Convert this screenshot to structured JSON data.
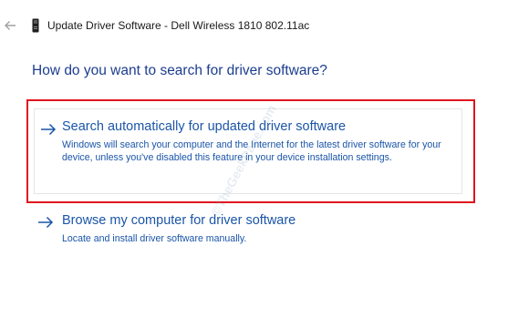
{
  "window": {
    "title": "Update Driver Software - Dell Wireless 1810 802.11ac",
    "back_icon": "back-arrow-icon",
    "device_icon": "device-icon"
  },
  "main": {
    "heading": "How do you want to search for driver software?",
    "options": [
      {
        "title": "Search automatically for updated driver software",
        "description": "Windows will search your computer and the Internet for the latest driver software for your device, unless you've disabled this feature in your device installation settings.",
        "icon": "right-arrow-icon",
        "highlighted": true
      },
      {
        "title": "Browse my computer for driver software",
        "description": "Locate and install driver software manually.",
        "icon": "right-arrow-icon",
        "highlighted": false
      }
    ]
  },
  "watermark": "©TheGeekPage.com",
  "colors": {
    "heading": "#1c3d8f",
    "link": "#1a55a8",
    "highlight_frame": "#e0141e",
    "back_arrow": "#a0a0a0"
  }
}
